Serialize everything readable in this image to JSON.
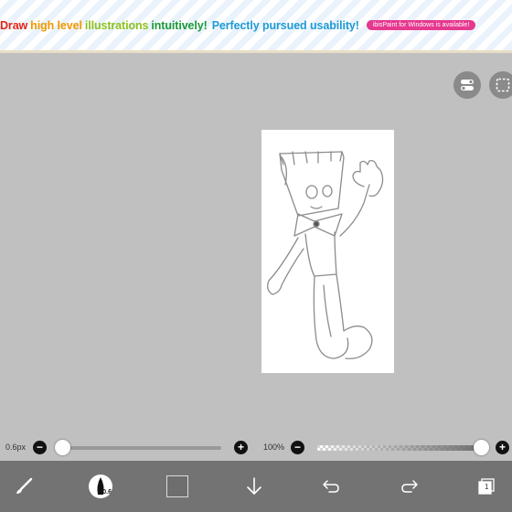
{
  "banner": {
    "part1": "Draw",
    "part2": "high level",
    "part3": "illustrations",
    "part4": "intuitively!",
    "part5": "Perfectly pursued usability!",
    "pill": "ibisPaint for Windows is available!"
  },
  "brush_slider": {
    "label": "0.6px",
    "value_fraction": 0.0
  },
  "opacity_slider": {
    "label": "100%",
    "value_fraction": 1.0
  },
  "toolbar": {
    "brush_size": "0.6",
    "layer_count": "1"
  },
  "colors": {
    "banner_red": "#e2231a",
    "banner_orange": "#f39800",
    "banner_lime": "#8cc11f",
    "banner_green": "#1a9a3a",
    "banner_blue": "#1e9ad6",
    "pill_pink": "#e6388f",
    "toolbar_bg": "#737373",
    "canvas_bg": "#c0c0c0",
    "current_color": "#6e6e6e"
  },
  "icons": [
    "brush-icon",
    "brush-size-indicator",
    "color-swatch",
    "download-arrow-icon",
    "undo-icon",
    "redo-icon",
    "layers-icon",
    "layer-settings-icon",
    "selection-icon"
  ]
}
